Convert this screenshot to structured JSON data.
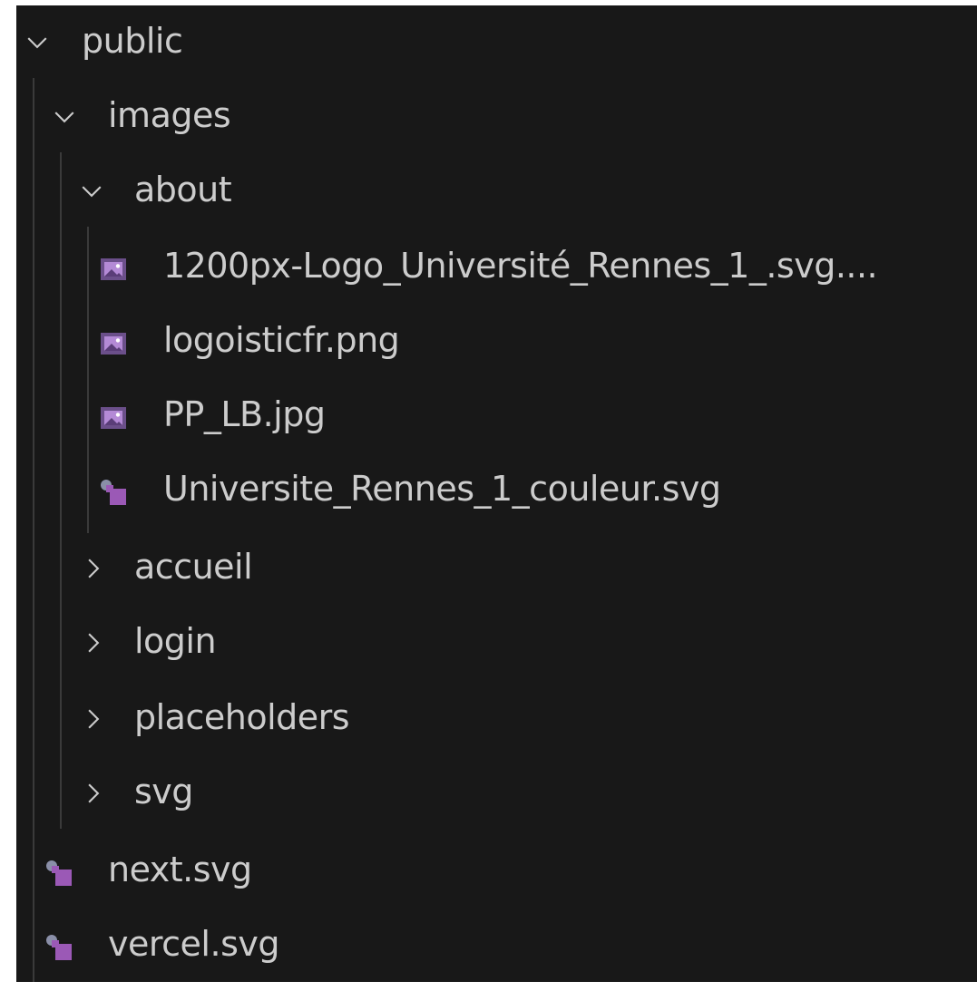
{
  "explorer": {
    "root": {
      "label": "public",
      "expanded": true,
      "icon": "chevron-down-icon"
    },
    "images": {
      "label": "images",
      "expanded": true,
      "icon": "chevron-down-icon"
    },
    "about": {
      "label": "about",
      "expanded": true,
      "icon": "chevron-down-icon",
      "files": [
        {
          "label": "1200px-Logo_Université_Rennes_1_.svg....",
          "icon": "image-file-icon"
        },
        {
          "label": "logoisticfr.png",
          "icon": "image-file-icon"
        },
        {
          "label": "PP_LB.jpg",
          "icon": "image-file-icon"
        },
        {
          "label": "Universite_Rennes_1_couleur.svg",
          "icon": "svg-file-icon"
        }
      ]
    },
    "collapsed_folders": [
      {
        "label": "accueil",
        "icon": "chevron-right-icon"
      },
      {
        "label": "login",
        "icon": "chevron-right-icon"
      },
      {
        "label": "placeholders",
        "icon": "chevron-right-icon"
      },
      {
        "label": "svg",
        "icon": "chevron-right-icon"
      }
    ],
    "root_files": [
      {
        "label": "next.svg",
        "icon": "svg-file-icon"
      },
      {
        "label": "vercel.svg",
        "icon": "svg-file-icon"
      }
    ]
  },
  "colors": {
    "background": "#181818",
    "text": "#cccccc",
    "indent_guide": "#3a3a3a",
    "image_icon": "#9b6fbd",
    "svg_icon": "#9b59b6"
  }
}
